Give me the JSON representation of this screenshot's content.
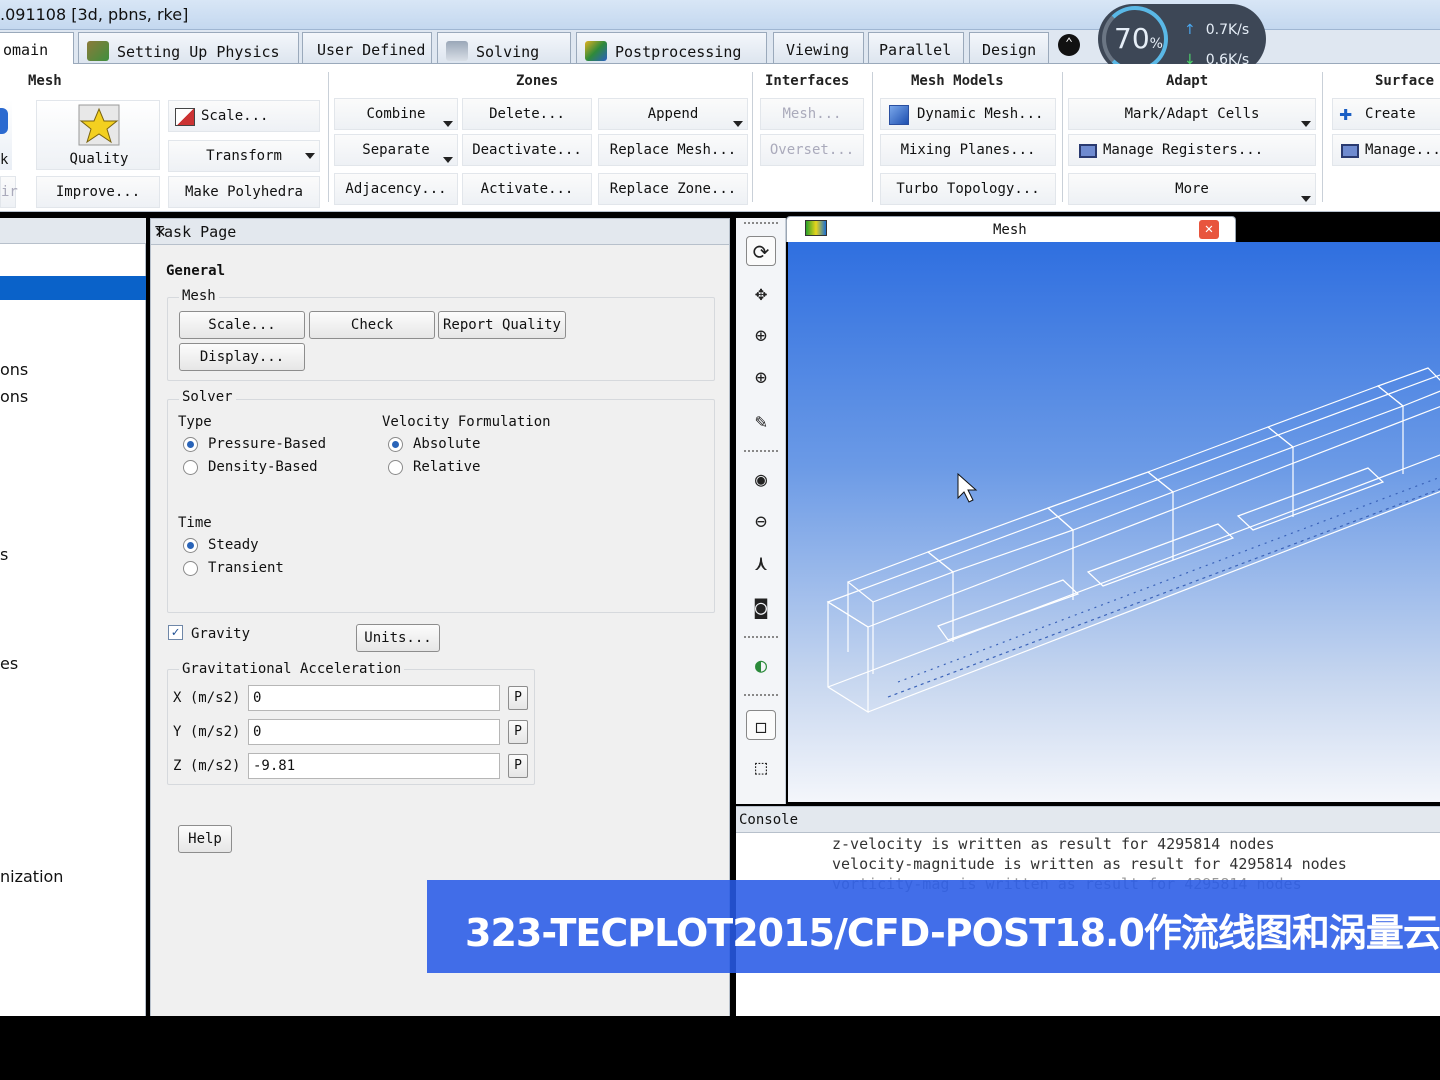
{
  "title_bar": {
    "text": ".091108  [3d, pbns, rke]"
  },
  "tabs": [
    {
      "label": "omain",
      "active": true
    },
    {
      "label": "Setting Up Physics"
    },
    {
      "label": "User Defined"
    },
    {
      "label": "Solving"
    },
    {
      "label": "Postprocessing"
    },
    {
      "label": "Viewing"
    },
    {
      "label": "Parallel"
    },
    {
      "label": "Design"
    }
  ],
  "network_badge": {
    "percent": "70",
    "percent_unit": "%",
    "upload": "0.7K/s",
    "download": "0.6K/s"
  },
  "ribbon": {
    "mesh": {
      "title": "Mesh",
      "k_label": "k",
      "ir_label": "ir",
      "quality": "Quality",
      "improve": "Improve...",
      "scale": "Scale...",
      "transform": "Transform",
      "make_polyhedra": "Make Polyhedra"
    },
    "zones": {
      "title": "Zones",
      "combine": "Combine",
      "separate": "Separate",
      "adjacency": "Adjacency...",
      "delete": "Delete...",
      "deactivate": "Deactivate...",
      "activate": "Activate...",
      "append": "Append",
      "replace_mesh": "Replace Mesh...",
      "replace_zone": "Replace Zone..."
    },
    "interfaces": {
      "title": "Interfaces",
      "mesh": "Mesh...",
      "overset": "Overset..."
    },
    "mesh_models": {
      "title": "Mesh Models",
      "dynamic_mesh": "Dynamic Mesh...",
      "mixing_planes": "Mixing Planes...",
      "turbo_topology": "Turbo Topology..."
    },
    "adapt": {
      "title": "Adapt",
      "mark_adapt": "Mark/Adapt Cells",
      "manage_registers": "Manage Registers...",
      "more": "More"
    },
    "surface": {
      "title": "Surface",
      "create": "Create",
      "manage": "Manage..."
    }
  },
  "outline": {
    "items": [
      "ons",
      "ons",
      "s",
      "es",
      "nization"
    ]
  },
  "task_page": {
    "header": "Task Page",
    "close": "✕",
    "general": "General",
    "mesh_group": "Mesh",
    "scale_btn": "Scale...",
    "check_btn": "Check",
    "report_quality_btn": "Report Quality",
    "display_btn": "Display...",
    "solver_group": "Solver",
    "type_label": "Type",
    "pressure_based": "Pressure-Based",
    "density_based": "Density-Based",
    "velocity_label": "Velocity Formulation",
    "absolute": "Absolute",
    "relative": "Relative",
    "time_label": "Time",
    "steady": "Steady",
    "transient": "Transient",
    "gravity": "Gravity",
    "gravity_checked": true,
    "units_btn": "Units...",
    "grav_accel_group": "Gravitational Acceleration",
    "x_label": "X (m/s2)",
    "x_value": "0",
    "y_label": "Y (m/s2)",
    "y_value": "0",
    "z_label": "Z (m/s2)",
    "z_value": "-9.81",
    "p_btn": "P",
    "help_btn": "Help"
  },
  "viewport": {
    "tab_label": "Mesh",
    "close": "✕"
  },
  "console": {
    "header": "Console",
    "lines": [
      "z-velocity is written as result for 4295814 nodes",
      "velocity-magnitude is written as result for 4295814 nodes",
      "vorticity-mag is written as result for 4295814 nodes"
    ]
  },
  "subtitle": {
    "text": "323-TECPLOT2015/CFD-POST18.0作流线图和涡量云"
  },
  "colors": {
    "selection": "#0a62c9",
    "banner": "#285ae6",
    "viewport_top": "#2f6fe0",
    "viewport_bottom": "#f4f6fb",
    "mesh_lines": "#ffffff"
  }
}
